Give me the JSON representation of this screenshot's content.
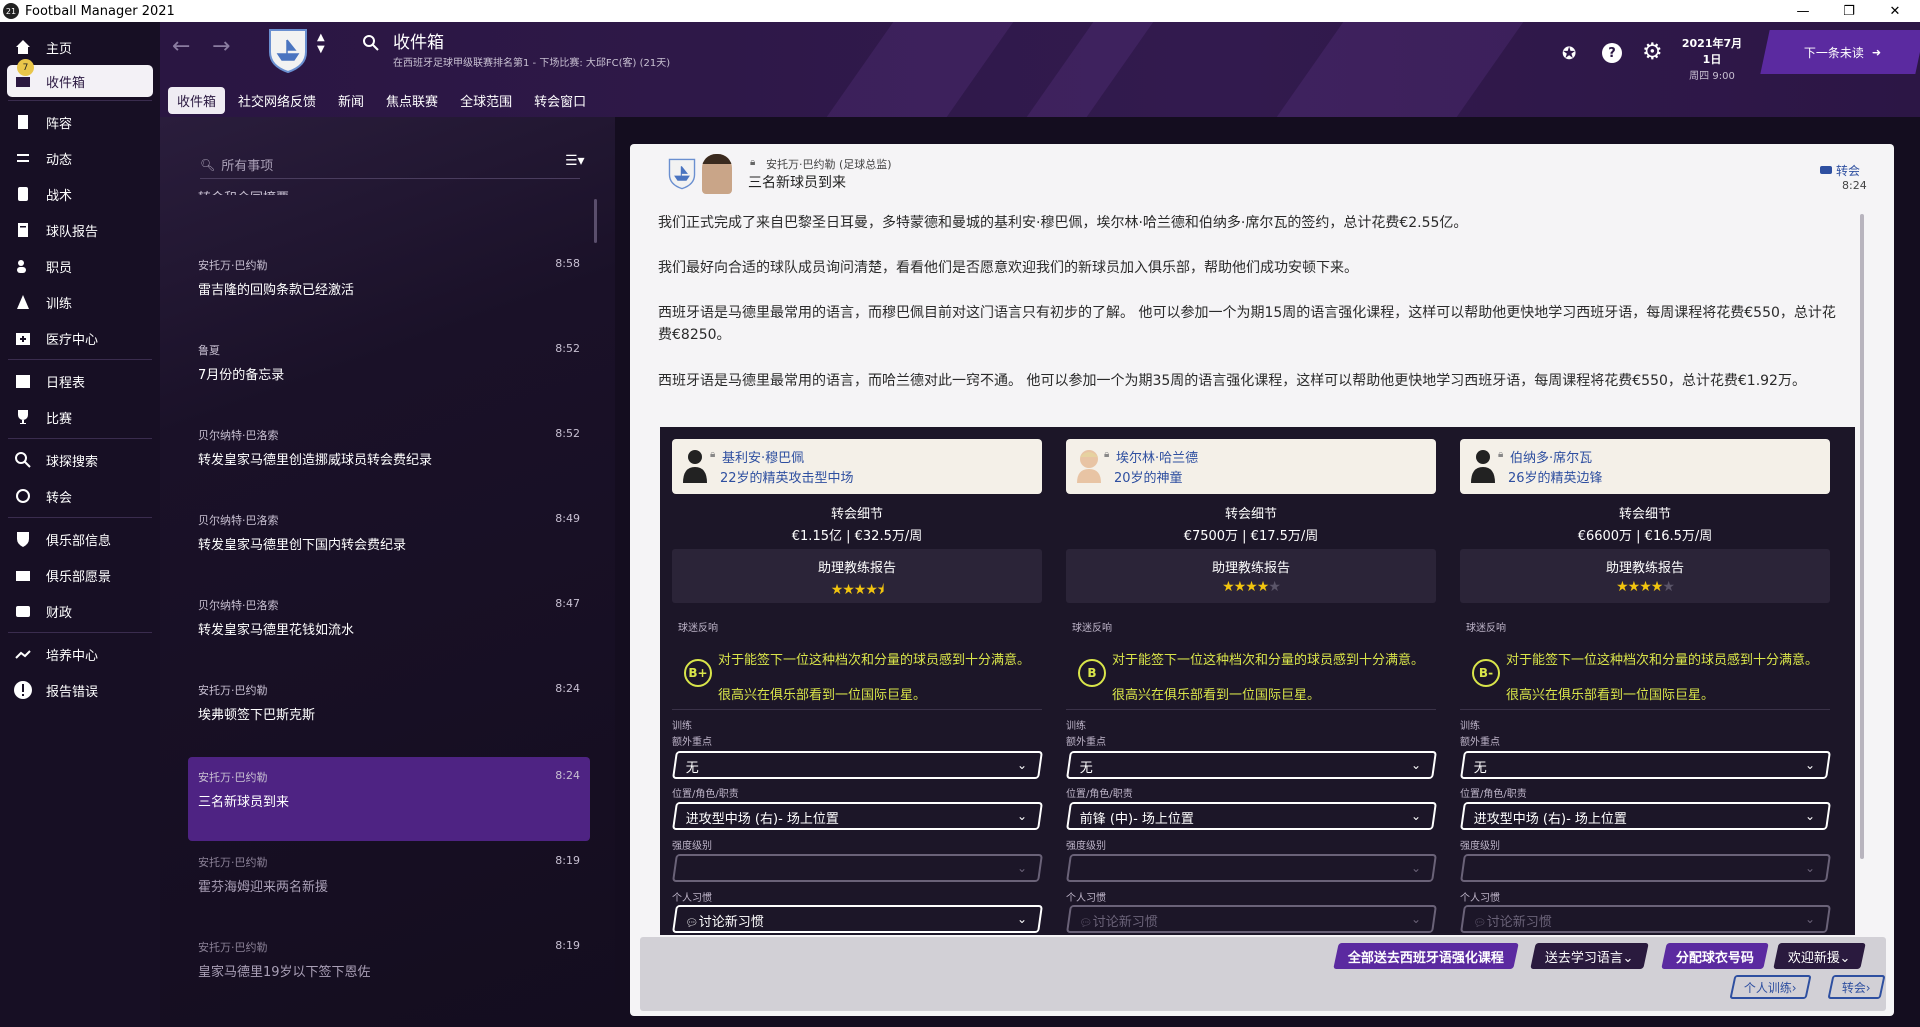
{
  "window": {
    "title": "Football Manager 2021",
    "logo": "21"
  },
  "sidebar": {
    "badge": "7",
    "items": [
      {
        "label": "主页",
        "icon": "home-icon"
      },
      {
        "label": "收件箱",
        "icon": "inbox-icon"
      },
      {
        "label": "阵容",
        "icon": "squad-icon"
      },
      {
        "label": "动态",
        "icon": "dynamics-icon"
      },
      {
        "label": "战术",
        "icon": "tactics-icon"
      },
      {
        "label": "球队报告",
        "icon": "report-icon"
      },
      {
        "label": "职员",
        "icon": "staff-icon"
      },
      {
        "label": "训练",
        "icon": "training-icon"
      },
      {
        "label": "医疗中心",
        "icon": "medical-icon"
      },
      {
        "label": "日程表",
        "icon": "calendar-icon"
      },
      {
        "label": "比赛",
        "icon": "trophy-icon"
      },
      {
        "label": "球探搜索",
        "icon": "search-icon"
      },
      {
        "label": "转会",
        "icon": "transfer-icon"
      },
      {
        "label": "俱乐部信息",
        "icon": "shield-icon"
      },
      {
        "label": "俱乐部愿景",
        "icon": "vision-icon"
      },
      {
        "label": "财政",
        "icon": "finance-icon"
      },
      {
        "label": "培养中心",
        "icon": "development-icon"
      },
      {
        "label": "报告错误",
        "icon": "alert-icon"
      }
    ]
  },
  "header": {
    "title": "收件箱",
    "subtitle": "在西班牙足球甲级联赛排名第1 - 下场比赛: 大邱FC(客) (21天)",
    "date": "2021年7月1日",
    "day_time": "周四 9:00",
    "next_button": "下一条未读",
    "tabs": [
      "收件箱",
      "社交网络反馈",
      "新闻",
      "焦点联赛",
      "全球范围",
      "转会窗口"
    ]
  },
  "inbox": {
    "search_placeholder": "所有事项",
    "partial_item": "转会和合同摘要",
    "messages": [
      {
        "from": "安托万·巴约勒",
        "subject": "雷吉隆的回购条款已经激活",
        "time": "8:58"
      },
      {
        "from": "鲁夏",
        "subject": "7月份的备忘录",
        "time": "8:52"
      },
      {
        "from": "贝尔纳特·巴洛索",
        "subject": "转发皇家马德里创造挪威球员转会费纪录",
        "time": "8:52"
      },
      {
        "from": "贝尔纳特·巴洛索",
        "subject": "转发皇家马德里创下国内转会费纪录",
        "time": "8:49"
      },
      {
        "from": "贝尔纳特·巴洛索",
        "subject": "转发皇家马德里花钱如流水",
        "time": "8:47"
      },
      {
        "from": "安托万·巴约勒",
        "subject": "埃弗顿签下巴斯克斯",
        "time": "8:24"
      },
      {
        "from": "安托万·巴约勒",
        "subject": "三名新球员到来",
        "time": "8:24"
      },
      {
        "from": "安托万·巴约勒",
        "subject": "霍芬海姆迎来两名新援",
        "time": "8:19"
      },
      {
        "from": "安托万·巴约勒",
        "subject": "皇家马德里19岁以下签下恩佐",
        "time": "8:19"
      }
    ]
  },
  "message": {
    "sender": "安托万·巴约勒 (足球总监)",
    "subject": "三名新球员到来",
    "tag": "转会",
    "time": "8:24",
    "paragraphs": [
      "我们正式完成了来自巴黎圣日耳曼，多特蒙德和曼城的基利安·穆巴佩，埃尔林·哈兰德和伯纳多·席尔瓦的签约，总计花费€2.55亿。",
      "我们最好向合适的球队成员询问清楚，看看他们是否愿意欢迎我们的新球员加入俱乐部，帮助他们成功安顿下来。",
      "西班牙语是马德里最常用的语言，而穆巴佩目前对这门语言只有初步的了解。 他可以参加一个为期15周的语言强化课程，这样可以帮助他更快地学习西班牙语，每周课程将花费€550，总计花费€8250。",
      "西班牙语是马德里最常用的语言，而哈兰德对此一窍不通。 他可以参加一个为期35周的语言强化课程，这样可以帮助他更快地学习西班牙语，每周课程将花费€550，总计花费€1.92万。"
    ]
  },
  "labels": {
    "transfer_details": "转会细节",
    "coach_report": "助理教练报告",
    "fan_reaction": "球迷反响",
    "training": "训练",
    "extra_focus": "额外重点",
    "position": "位置/角色/职责",
    "intensity": "强度级别",
    "habit": "个人习惯",
    "habit_value": "讨论新习惯"
  },
  "players": [
    {
      "name": "基利安·穆巴佩",
      "desc": "22岁的精英攻击型中场",
      "fee": "€1.15亿 | €32.5万/周",
      "stars": 4.5,
      "rating": "B+",
      "fan1": "对于能签下一位这种档次和分量的球员感到十分满意。",
      "fan2": "很高兴在俱乐部看到一位国际巨星。",
      "focus": "无",
      "position": "进攻型中场 (右)- 场上位置"
    },
    {
      "name": "埃尔林·哈兰德",
      "desc": "20岁的神童",
      "fee": "€7500万 | €17.5万/周",
      "stars": 4,
      "rating": "B",
      "fan1": "对于能签下一位这种档次和分量的球员感到十分满意。",
      "fan2": "很高兴在俱乐部看到一位国际巨星。",
      "focus": "无",
      "position": "前锋 (中)- 场上位置"
    },
    {
      "name": "伯纳多·席尔瓦",
      "desc": "26岁的精英边锋",
      "fee": "€6600万 | €16.5万/周",
      "stars": 4,
      "rating": "B-",
      "fan1": "对于能签下一位这种档次和分量的球员感到十分满意。",
      "fan2": "很高兴在俱乐部看到一位国际巨星。",
      "focus": "无",
      "position": "进攻型中场 (右)- 场上位置"
    }
  ],
  "actions": {
    "all_language": "全部送去西班牙语强化课程",
    "send_language": "送去学习语言",
    "assign_number": "分配球衣号码",
    "welcome": "欢迎新援",
    "individual_training": "个人训练",
    "transfer": "转会"
  },
  "colors": {
    "accent": "#4e2383",
    "header": "#2a1642",
    "rating": "#d9e54a"
  }
}
